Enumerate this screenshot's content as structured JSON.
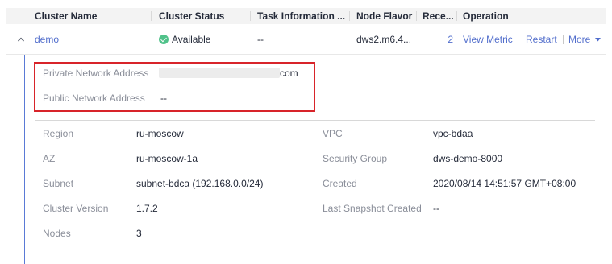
{
  "table": {
    "headers": {
      "cluster_name": "Cluster Name",
      "cluster_status": "Cluster Status",
      "task_information": "Task Information ...",
      "node_flavor": "Node Flavor",
      "recent": "Rece...",
      "operation": "Operation"
    },
    "row": {
      "name": "demo",
      "status": "Available",
      "task": "--",
      "flavor": "dws2.m6.4...",
      "recent": "2",
      "actions": {
        "view_metric": "View Metric",
        "restart": "Restart",
        "more": "More"
      }
    }
  },
  "details": {
    "private_network_address_label": "Private Network Address",
    "private_network_address_suffix": "com",
    "public_network_address_label": "Public Network Address",
    "public_network_address_value": "--",
    "left": [
      {
        "label": "Region",
        "value": "ru-moscow"
      },
      {
        "label": "AZ",
        "value": "ru-moscow-1a"
      },
      {
        "label": "Subnet",
        "value": "subnet-bdca (192.168.0.0/24)"
      },
      {
        "label": "Cluster Version",
        "value": "1.7.2"
      },
      {
        "label": "Nodes",
        "value": "3"
      }
    ],
    "right": [
      {
        "label": "VPC",
        "value": "vpc-bdaa"
      },
      {
        "label": "Security Group",
        "value": "dws-demo-8000"
      },
      {
        "label": "Created",
        "value": "2020/08/14 14:51:57 GMT+08:00"
      },
      {
        "label": "Last Snapshot Created",
        "value": "--"
      }
    ]
  },
  "colors": {
    "link": "#526ecc",
    "highlight_border": "#d8242a",
    "status_available": "#50c28a",
    "header_bg": "#f3f3f3"
  },
  "icons": {
    "expand": "chevron-up-icon",
    "status": "check-circle-icon",
    "more": "caret-down-icon"
  }
}
